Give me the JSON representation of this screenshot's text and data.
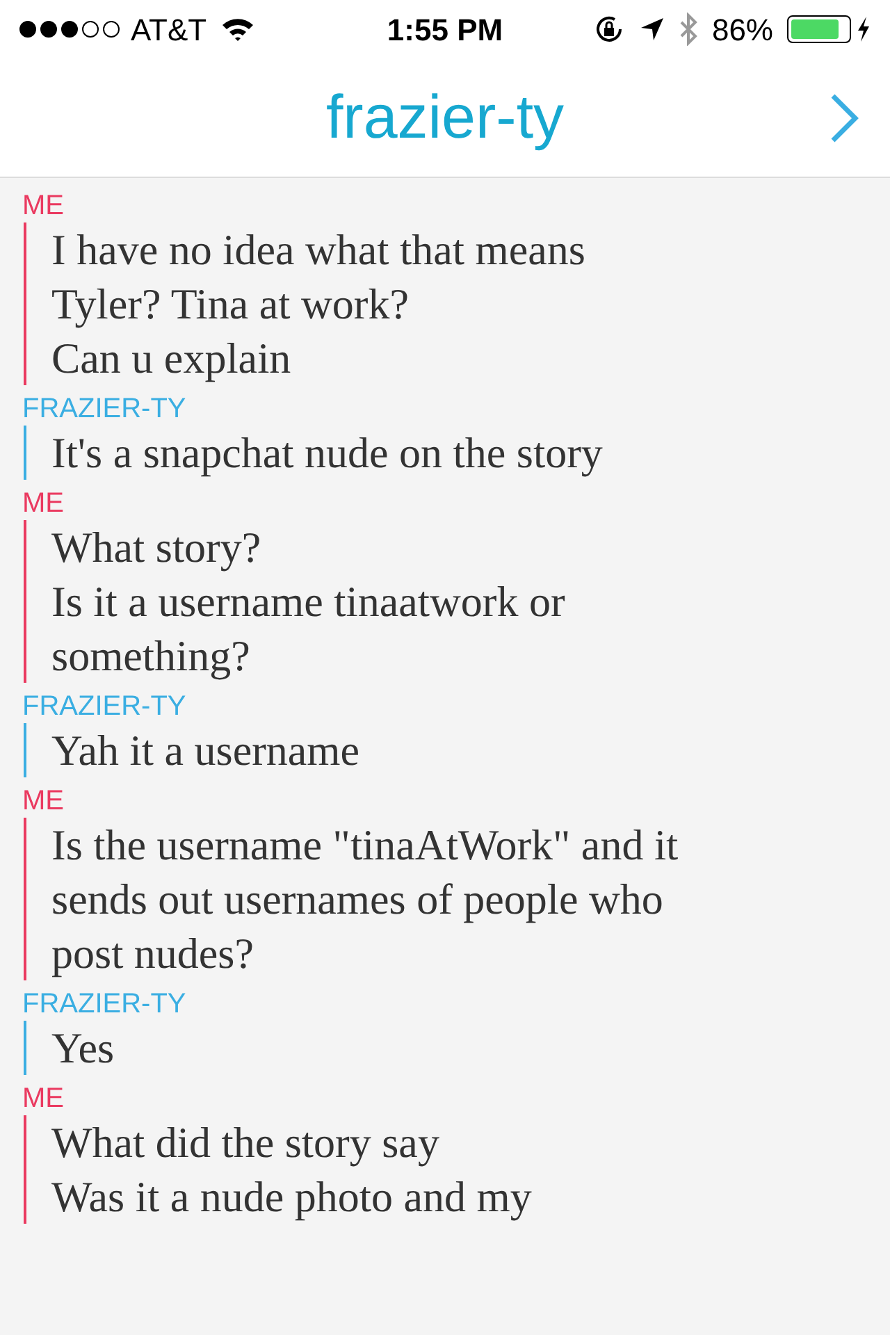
{
  "status_bar": {
    "carrier": "AT&T",
    "time": "1:55 PM",
    "battery": "86%"
  },
  "header": {
    "title": "frazier-ty"
  },
  "messages": [
    {
      "sender": "ME",
      "kind": "me",
      "lines": [
        "I have no idea what that means",
        "Tyler? Tina at work?",
        "Can u explain"
      ]
    },
    {
      "sender": "FRAZIER-TY",
      "kind": "them",
      "lines": [
        "It's a snapchat nude on the story"
      ]
    },
    {
      "sender": "ME",
      "kind": "me",
      "lines": [
        "What story?",
        "Is it a username tinaatwork or",
        "something?"
      ]
    },
    {
      "sender": "FRAZIER-TY",
      "kind": "them",
      "lines": [
        "Yah it a username"
      ]
    },
    {
      "sender": "ME",
      "kind": "me",
      "lines": [
        "Is the username \"tinaAtWork\" and it",
        "sends out usernames of people who",
        "post nudes?"
      ]
    },
    {
      "sender": "FRAZIER-TY",
      "kind": "them",
      "lines": [
        "Yes"
      ]
    },
    {
      "sender": "ME",
      "kind": "me",
      "lines": [
        "What did the story say",
        "Was it a nude photo and my"
      ]
    }
  ]
}
